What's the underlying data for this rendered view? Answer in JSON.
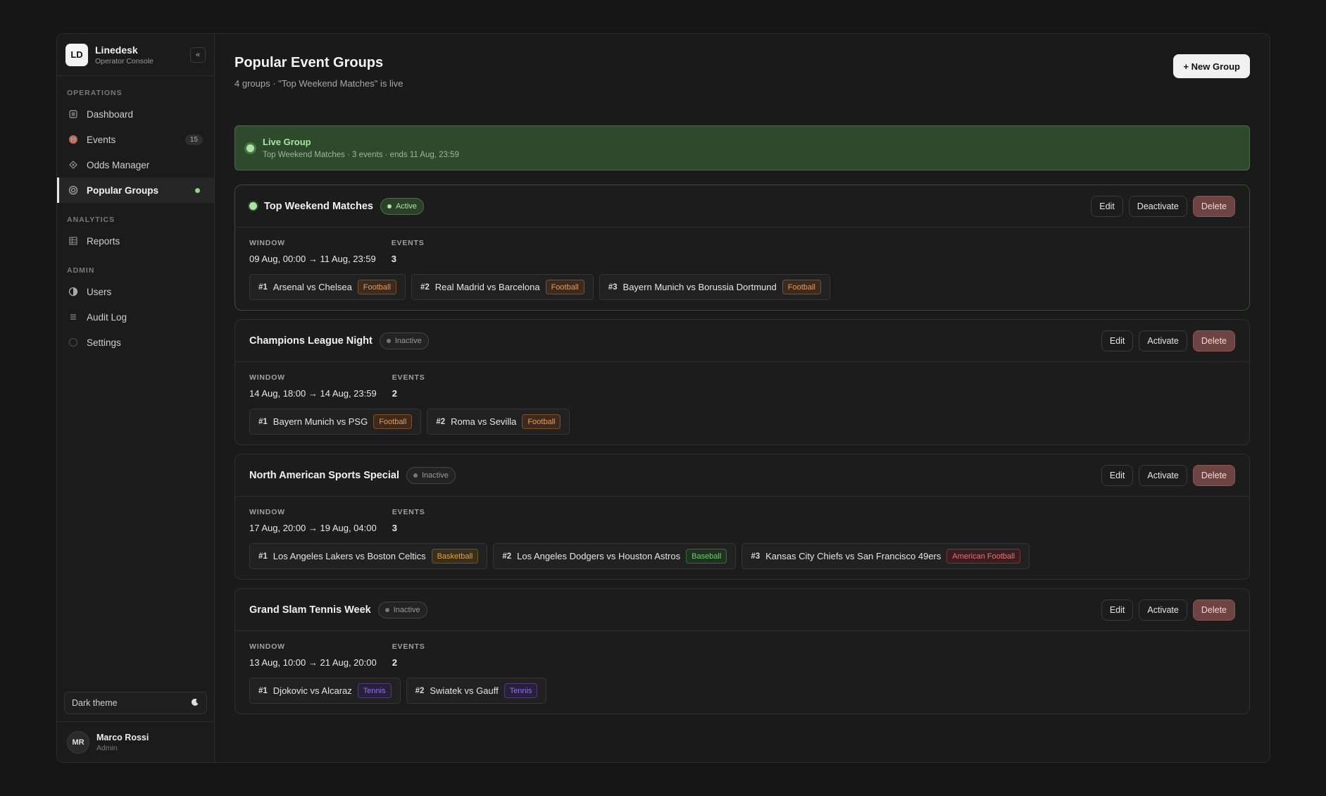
{
  "brand": {
    "logo": "LD",
    "name": "Linedesk",
    "subtitle": "Operator Console",
    "collapse_icon": "«"
  },
  "sidebar": {
    "sections": [
      {
        "label": "OPERATIONS",
        "items": [
          {
            "label": "Dashboard",
            "icon": "dashboard-icon"
          },
          {
            "label": "Events",
            "icon": "events-icon",
            "count": "15"
          },
          {
            "label": "Odds Manager",
            "icon": "odds-icon"
          },
          {
            "label": "Popular Groups",
            "icon": "groups-icon",
            "active": true
          }
        ]
      },
      {
        "label": "ANALYTICS",
        "items": [
          {
            "label": "Reports",
            "icon": "reports-icon"
          }
        ]
      },
      {
        "label": "ADMIN",
        "items": [
          {
            "label": "Users",
            "icon": "users-icon"
          },
          {
            "label": "Audit Log",
            "icon": "audit-log-icon"
          },
          {
            "label": "Settings",
            "icon": "settings-icon"
          }
        ]
      }
    ],
    "theme_label": "Dark theme",
    "user": {
      "initials": "MR",
      "name": "Marco Rossi",
      "role": "Admin"
    }
  },
  "header": {
    "title": "Popular Event Groups",
    "subtitle": "4 groups · \"Top Weekend Matches\" is live",
    "new_button": "+ New Group"
  },
  "live_banner": {
    "title": "Live Group",
    "subtitle": "Top Weekend Matches · 3 events · ends 11 Aug, 23:59"
  },
  "labels": {
    "window": "WINDOW",
    "events": "EVENTS",
    "edit": "Edit",
    "activate": "Activate",
    "deactivate": "Deactivate",
    "delete": "Delete"
  },
  "groups": [
    {
      "name": "Top Weekend Matches",
      "status": "Active",
      "window": "09 Aug, 00:00 → 11 Aug, 23:59",
      "event_count": "3",
      "events": [
        {
          "rank": "#1",
          "name": "Arsenal vs Chelsea",
          "sport": "Football"
        },
        {
          "rank": "#2",
          "name": "Real Madrid vs Barcelona",
          "sport": "Football"
        },
        {
          "rank": "#3",
          "name": "Bayern Munich vs Borussia Dortmund",
          "sport": "Football"
        }
      ]
    },
    {
      "name": "Champions League Night",
      "status": "Inactive",
      "window": "14 Aug, 18:00 → 14 Aug, 23:59",
      "event_count": "2",
      "events": [
        {
          "rank": "#1",
          "name": "Bayern Munich vs PSG",
          "sport": "Football"
        },
        {
          "rank": "#2",
          "name": "Roma vs Sevilla",
          "sport": "Football"
        }
      ]
    },
    {
      "name": "North American Sports Special",
      "status": "Inactive",
      "window": "17 Aug, 20:00 → 19 Aug, 04:00",
      "event_count": "3",
      "events": [
        {
          "rank": "#1",
          "name": "Los Angeles Lakers vs Boston Celtics",
          "sport": "Basketball"
        },
        {
          "rank": "#2",
          "name": "Los Angeles Dodgers vs Houston Astros",
          "sport": "Baseball"
        },
        {
          "rank": "#3",
          "name": "Kansas City Chiefs vs San Francisco 49ers",
          "sport": "American Football"
        }
      ]
    },
    {
      "name": "Grand Slam Tennis Week",
      "status": "Inactive",
      "window": "13 Aug, 10:00 → 21 Aug, 20:00",
      "event_count": "2",
      "events": [
        {
          "rank": "#1",
          "name": "Djokovic vs Alcaraz",
          "sport": "Tennis"
        },
        {
          "rank": "#2",
          "name": "Swiatek vs Gauff",
          "sport": "Tennis"
        }
      ]
    }
  ]
}
